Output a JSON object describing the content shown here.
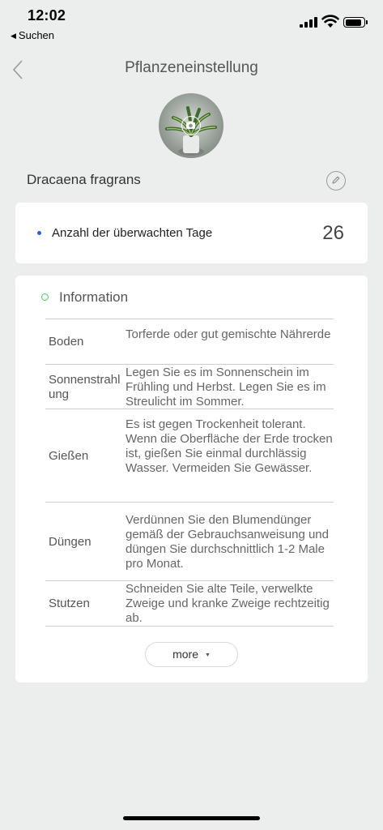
{
  "status_bar": {
    "time": "12:02",
    "back_app": "Suchen"
  },
  "nav": {
    "title": "Pflanzeneinstellung"
  },
  "plant": {
    "name": "Dracaena fragrans"
  },
  "monitored": {
    "label": "Anzahl der überwachten Tage",
    "value": "26"
  },
  "info": {
    "title": "Information",
    "rows": [
      {
        "key": "Boden",
        "value": "Torferde oder gut gemischte Nährerde"
      },
      {
        "key": "Sonnenstrahlung",
        "value": "Legen Sie es im Sonnenschein im Frühling und Herbst. Legen Sie es im Streulicht im Sommer."
      },
      {
        "key": "Gießen",
        "value": "Es ist gegen Trockenheit tolerant. Wenn die Oberfläche der Erde trocken ist, gießen Sie einmal durchlässig Wasser. Vermeiden Sie Gewässer."
      },
      {
        "key": "Düngen",
        "value": "Verdünnen Sie den Blumendünger gemäß der Gebrauchsanweisung und düngen Sie durchschnittlich 1-2 Male pro Monat."
      },
      {
        "key": "Stutzen",
        "value": "Schneiden Sie alte Teile, verwelkte Zweige und kranke Zweige rechtzeitig ab."
      }
    ],
    "more_label": "more"
  },
  "colors": {
    "background": "#eceeee",
    "accent_blue": "#2e5fd0",
    "accent_green": "#4cc85c"
  }
}
